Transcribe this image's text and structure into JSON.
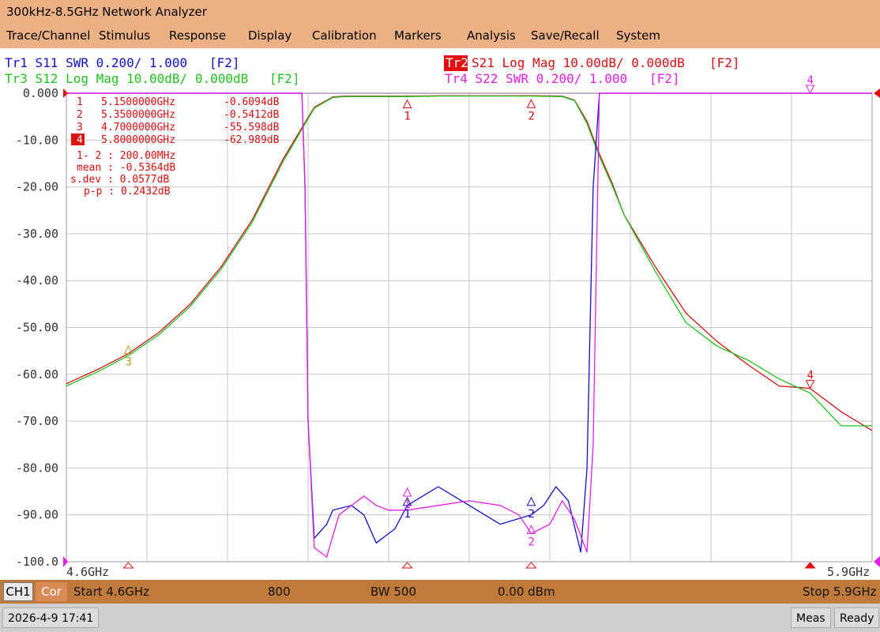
{
  "window": {
    "title": "300kHz-8.5GHz Network Analyzer"
  },
  "menu": [
    "Trace/Channel",
    "Stimulus",
    "Response",
    "Display",
    "Calibration",
    "Markers",
    "Analysis",
    "Save/Recall",
    "System"
  ],
  "traces": [
    {
      "id": "Tr1",
      "text": "Tr1 S11 SWR 0.200/ 1.000",
      "tag": "[F2]",
      "color": "#1010c0"
    },
    {
      "id": "Tr2",
      "text": "S21 Log Mag 10.00dB/ 0.000dB",
      "tag": "[F2]",
      "color": "#d01010",
      "active": true
    },
    {
      "id": "Tr3",
      "text": "Tr3 S12 Log Mag 10.00dB/ 0.000dB",
      "tag": "[F2]",
      "color": "#20c020"
    },
    {
      "id": "Tr4",
      "text": "Tr4 S22 SWR 0.200/ 1.000",
      "tag": "[F2]",
      "color": "#e020e0"
    }
  ],
  "y_axis": {
    "ticks": [
      "0.000",
      "-10.00",
      "-20.00",
      "-30.00",
      "-40.00",
      "-50.00",
      "-60.00",
      "-70.00",
      "-80.00",
      "-90.00",
      "-100.0"
    ],
    "min": -100,
    "max": 0
  },
  "x_axis": {
    "start_label": "4.6GHz",
    "stop_label": "5.9GHz",
    "start": 4.6,
    "stop": 5.9
  },
  "markers": [
    {
      "num": "1",
      "freq": "5.1500000GHz",
      "value": "-0.6094dB"
    },
    {
      "num": "2",
      "freq": "5.3500000GHz",
      "value": "-0.5412dB"
    },
    {
      "num": "3",
      "freq": "4.7000000GHz",
      "value": "-55.598dB"
    },
    {
      "num": "4",
      "freq": "5.8000000GHz",
      "value": "-62.989dB",
      "active": true
    }
  ],
  "stats": {
    "span": "1- 2 : 200.00MHz",
    "mean": "mean : -0.5364dB",
    "sdev": "s.dev : 0.0577dB",
    "pp": "p-p : 0.2432dB"
  },
  "chart_data": {
    "type": "line",
    "xlabel": "",
    "ylabel": "",
    "xlim": [
      4.6,
      5.9
    ],
    "ylim": [
      -100,
      0
    ],
    "grid": true,
    "series": [
      {
        "name": "S21",
        "color": "#d01010",
        "x": [
          4.6,
          4.65,
          4.7,
          4.75,
          4.8,
          4.85,
          4.9,
          4.95,
          5.0,
          5.03,
          5.05,
          5.07,
          5.1,
          5.15,
          5.2,
          5.25,
          5.3,
          5.35,
          5.4,
          5.42,
          5.44,
          5.46,
          5.48,
          5.5,
          5.55,
          5.6,
          5.65,
          5.7,
          5.75,
          5.8,
          5.85,
          5.9
        ],
        "y": [
          -62,
          -59,
          -55.6,
          -51,
          -45,
          -37,
          -27,
          -14,
          -3,
          -0.8,
          -0.6,
          -0.6,
          -0.6,
          -0.61,
          -0.55,
          -0.55,
          -0.55,
          -0.54,
          -0.6,
          -1.5,
          -6,
          -13,
          -19,
          -26,
          -37,
          -47,
          -53,
          -58,
          -62.5,
          -63,
          -68,
          -72
        ]
      },
      {
        "name": "S12",
        "color": "#20c020",
        "x": [
          4.6,
          4.65,
          4.7,
          4.75,
          4.8,
          4.85,
          4.9,
          4.95,
          5.0,
          5.03,
          5.05,
          5.07,
          5.1,
          5.15,
          5.2,
          5.25,
          5.3,
          5.35,
          5.4,
          5.42,
          5.44,
          5.46,
          5.48,
          5.5,
          5.55,
          5.6,
          5.65,
          5.7,
          5.75,
          5.8,
          5.85,
          5.9
        ],
        "y": [
          -62.5,
          -59.5,
          -56,
          -51.5,
          -45.5,
          -37.5,
          -27.5,
          -14.5,
          -3.2,
          -0.9,
          -0.7,
          -0.7,
          -0.7,
          -0.7,
          -0.6,
          -0.6,
          -0.6,
          -0.6,
          -0.7,
          -1.6,
          -6.5,
          -13.5,
          -19.5,
          -26,
          -38,
          -49,
          -54,
          -57,
          -61,
          -64,
          -71,
          -71
        ]
      },
      {
        "name": "S11",
        "color": "#1010c0",
        "x": [
          4.6,
          4.98,
          4.985,
          4.99,
          5.0,
          5.02,
          5.03,
          5.06,
          5.08,
          5.1,
          5.13,
          5.15,
          5.2,
          5.25,
          5.3,
          5.35,
          5.37,
          5.39,
          5.41,
          5.43,
          5.44,
          5.45,
          5.46,
          5.9
        ],
        "y": [
          0,
          0,
          -20,
          -70,
          -95,
          -92,
          -89,
          -88,
          -90,
          -96,
          -93,
          -88,
          -84,
          -88,
          -92,
          -90,
          -88,
          -84,
          -87,
          -98,
          -80,
          -20,
          0,
          0
        ]
      },
      {
        "name": "S22",
        "color": "#e020e0",
        "x": [
          4.6,
          4.98,
          4.985,
          4.99,
          5.0,
          5.02,
          5.04,
          5.08,
          5.1,
          5.12,
          5.15,
          5.2,
          5.25,
          5.3,
          5.33,
          5.35,
          5.38,
          5.4,
          5.42,
          5.44,
          5.45,
          5.46,
          5.9
        ],
        "y": [
          0,
          0,
          -20,
          -70,
          -97,
          -99,
          -90,
          -86,
          -88,
          -89,
          -89,
          -88,
          -87,
          -88,
          -90,
          -94,
          -92,
          -87,
          -91,
          -98,
          -75,
          0,
          0
        ]
      }
    ]
  },
  "bottom": {
    "ch": "CH1",
    "cor": "Cor",
    "start": "Start 4.6GHz",
    "points": "800",
    "bw": "BW 500",
    "power": "0.00 dBm",
    "stop": "Stop 5.9GHz"
  },
  "status": {
    "datetime": "2026-4-9 17:41",
    "meas": "Meas",
    "ready": "Ready"
  },
  "trace_markers_top": [
    "1",
    "2",
    "4"
  ]
}
